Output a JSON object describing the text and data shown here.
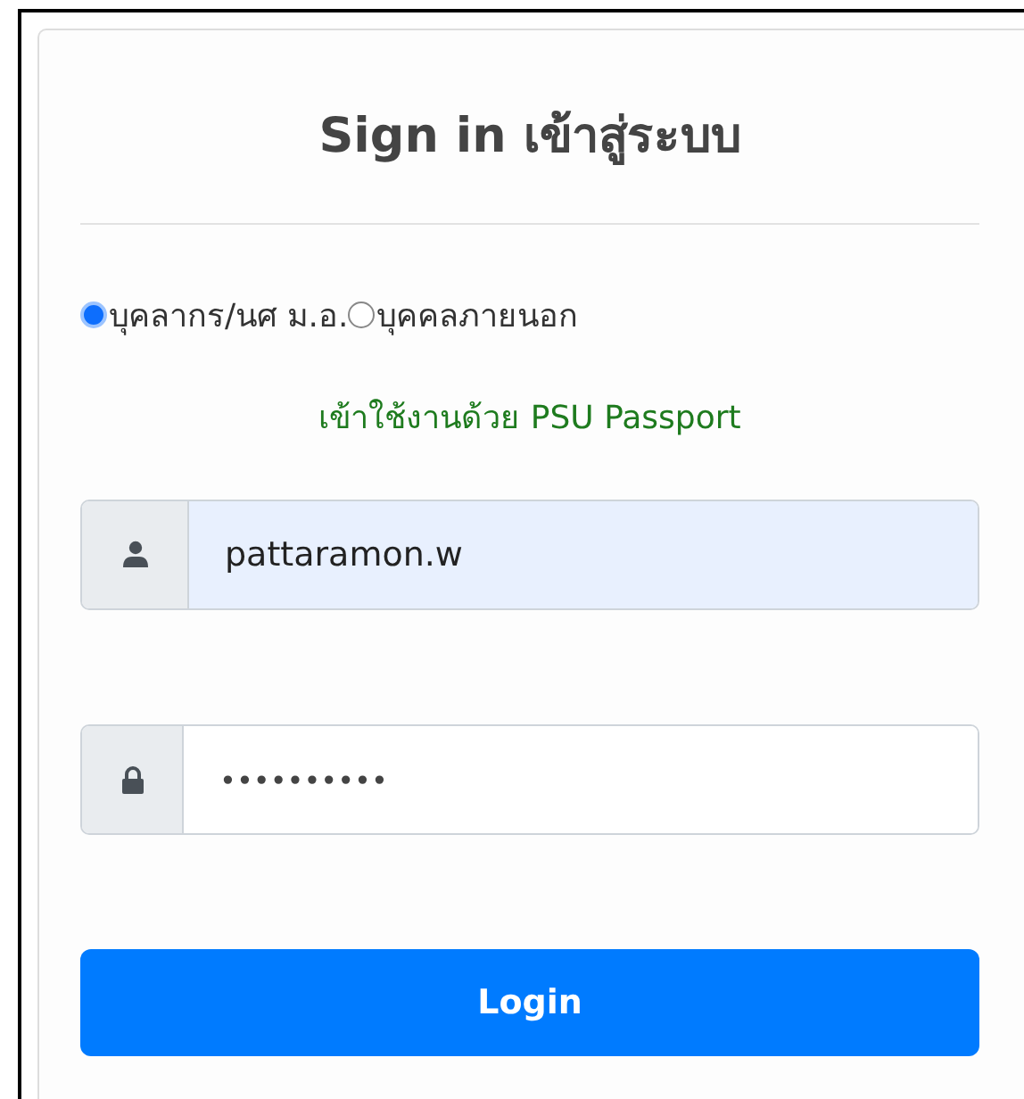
{
  "title": "Sign in เข้าสู่ระบบ",
  "user_types": [
    {
      "label": "บุคลากร/นศ ม.อ.",
      "selected": true
    },
    {
      "label": "บุคคลภายนอก",
      "selected": false
    }
  ],
  "hint": "เข้าใช้งานด้วย PSU Passport",
  "username": {
    "value": "pattaramon.w"
  },
  "password": {
    "value": "••••••••••"
  },
  "login_button": "Login"
}
